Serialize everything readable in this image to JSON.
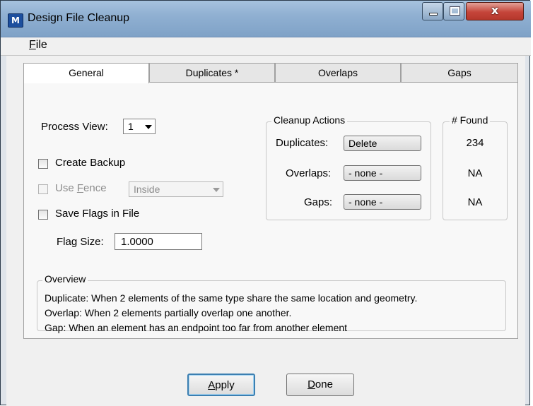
{
  "window": {
    "title": "Design File Cleanup",
    "close_glyph": "x"
  },
  "menu": {
    "file_accel": "F",
    "file_rest": "ile"
  },
  "tabs": [
    {
      "label": "General",
      "active": true
    },
    {
      "label": "Duplicates *",
      "active": false
    },
    {
      "label": "Overlaps",
      "active": false
    },
    {
      "label": "Gaps",
      "active": false
    }
  ],
  "general": {
    "process_view_label": "Process View:",
    "process_view_value": "1",
    "create_backup_label": "Create Backup",
    "create_backup_checked": false,
    "use_fence_pre": "Use ",
    "use_fence_accel": "F",
    "use_fence_post": "ence",
    "use_fence_checked": false,
    "use_fence_mode": "Inside",
    "save_flags_label": "Save Flags in File",
    "save_flags_checked": false,
    "flag_size_label": "Flag Size:",
    "flag_size_value": "1.0000"
  },
  "cleanup_actions": {
    "title": "Cleanup Actions",
    "rows": [
      {
        "label": "Duplicates:",
        "value": "Delete"
      },
      {
        "label": "Overlaps:",
        "value": "- none -"
      },
      {
        "label": "Gaps:",
        "value": "- none -"
      }
    ]
  },
  "found": {
    "title": "# Found",
    "values": [
      "234",
      "NA",
      "NA"
    ]
  },
  "overview": {
    "title": "Overview",
    "lines": [
      "Duplicate: When 2 elements of the same type share the same location and geometry.",
      "Overlap: When 2 elements partially overlap one another.",
      "Gap: When an element has an endpoint too far from another element"
    ]
  },
  "buttons": {
    "apply_accel": "A",
    "apply_rest": "pply",
    "done_accel": "D",
    "done_rest": "one"
  },
  "colors": {
    "titlebar": "#90b0d2",
    "close_button": "#c5453a",
    "default_button_border": "#3c7fb1"
  }
}
